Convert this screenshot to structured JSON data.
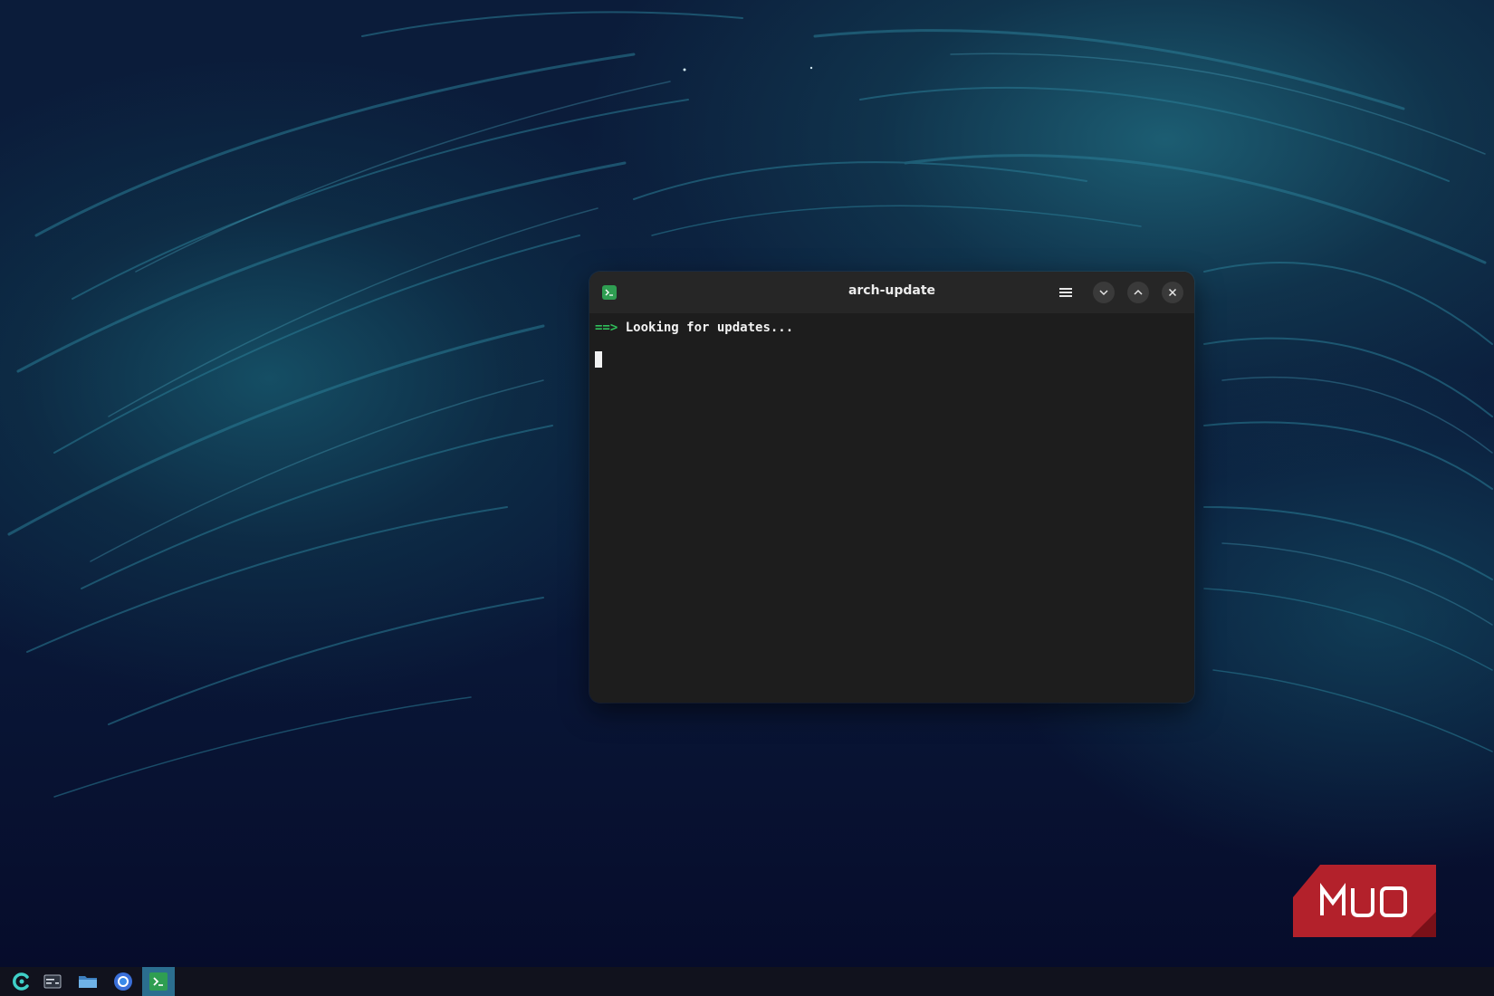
{
  "window": {
    "title": "arch-update",
    "app_icon": "terminal-app-icon",
    "buttons": {
      "menu": "hamburger-menu-icon",
      "minimize": "chevron-down-icon",
      "maximize": "chevron-up-icon",
      "close": "close-icon"
    }
  },
  "terminal": {
    "prompt_arrow": "==>",
    "message": " Looking for updates..."
  },
  "watermark": {
    "text": "MUO",
    "color": "#b3212b"
  },
  "taskbar": {
    "items": [
      {
        "icon": "launcher-icon"
      },
      {
        "icon": "overview-icon"
      },
      {
        "icon": "file-manager-icon"
      },
      {
        "icon": "chromium-browser-icon"
      },
      {
        "icon": "terminal-icon",
        "active": true
      }
    ]
  },
  "colors": {
    "prompt_green": "#2fbf5a",
    "terminal_bg": "#1d1d1d",
    "titlebar_bg": "#262626",
    "active_task": "#2b6e8f"
  }
}
